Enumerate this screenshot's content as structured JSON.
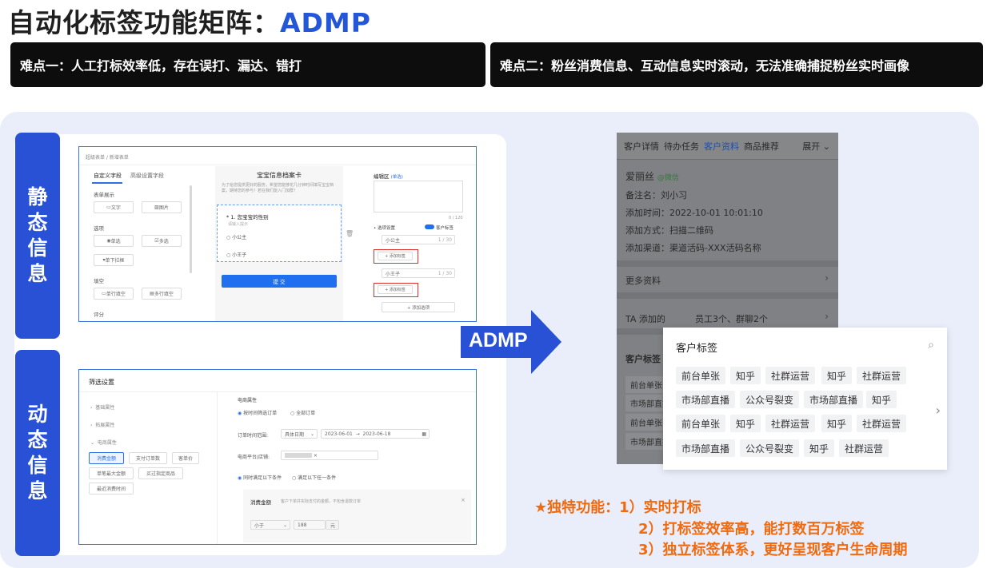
{
  "title": {
    "main": "自动化标签功能矩阵：",
    "accent": "ADMP"
  },
  "pain_points": [
    "难点一：人工打标效率低，存在误打、漏达、错打",
    "难点二：粉丝消费信息、互动信息实时滚动，无法准确捕捉粉丝实时画像"
  ],
  "side_labels": {
    "static": [
      "静",
      "态",
      "信",
      "息"
    ],
    "dynamic": [
      "动",
      "态",
      "信",
      "息"
    ]
  },
  "static_shot": {
    "breadcrumb": "超级表单 / 新增表单",
    "tabs": [
      "自定义字段",
      "高级设置字段"
    ],
    "sections": [
      {
        "title": "表单展示",
        "items": [
          "文字",
          "图片"
        ]
      },
      {
        "title": "选项",
        "items": [
          "单选",
          "多选",
          "单下拉框"
        ]
      },
      {
        "title": "填空",
        "items": [
          "单行填空",
          "多行填空"
        ]
      },
      {
        "title": "评分",
        "items": []
      }
    ],
    "card_title": "宝宝信息档案卡",
    "card_desc": "为了给您提供更好的服务，希望您能够花几分钟时间填写宝宝档案，期待您的参与！若在我们能入门加群！",
    "question": "* 1. 您宝宝的性别",
    "question_hint": "请输入提示",
    "options": [
      "小公主",
      "小王子"
    ],
    "submit": "提 交",
    "edit_title": "编辑区",
    "edit_sub": "(单选)",
    "counter": "0 / 120",
    "option_setting": "• 选项设置",
    "customer_tag": "客户标签",
    "edit_options": [
      {
        "value": "小公主",
        "count": "1 / 30"
      },
      {
        "value": "小王子",
        "count": "1 / 30"
      }
    ],
    "add_tag": "+ 添加标签",
    "add_option": "+ 添加选项"
  },
  "dynamic_shot": {
    "title": "筛选设置",
    "attrs": [
      "基础属性",
      "拓展属性",
      "电商属性"
    ],
    "buttons": [
      "消费金额",
      "支付订单数",
      "客单价",
      "单笔最大金额",
      "买过指定商品",
      "最近消费时间"
    ],
    "ecom_title": "电商属性",
    "radio1": [
      "按时间筛选订单",
      "全部订单"
    ],
    "order_time_label": "订单时间范围:",
    "date_mode": "具体日期",
    "date_from": "2023-06-01",
    "date_to": "2023-06-18",
    "platform_label": "电商平台/店铺:",
    "radio2": [
      "同时满足以下条件",
      "满足以下任一条件"
    ],
    "cond_title": "消费金额",
    "cond_desc": "客户下单并实际支付的金额，不包含退款订单",
    "cond_op": "小于",
    "cond_value": "188",
    "cond_unit": "元"
  },
  "arrow_label": "ADMP",
  "phone": {
    "tabs": [
      "客户详情",
      "待办任务",
      "客户资料",
      "商品推荐"
    ],
    "active_tab": 2,
    "expand": "展开",
    "name": "爱丽丝",
    "wechat": "@微信",
    "rows": [
      "备注名：刘小习",
      "添加时间：2022-10-01 10:01:10",
      "添加方式：扫描二维码",
      "添加渠道：渠道活码-XXX活码名称"
    ],
    "more": "更多资料",
    "ta_label": "TA 添加的",
    "ta_value": "员工3个、群聊2个",
    "tag_section": "客户标签",
    "left_tags": [
      "前台单张",
      "市场部直播",
      "前台单张",
      "市场部直播"
    ]
  },
  "tag_card": {
    "title": "客户标签",
    "rows": [
      [
        "前台单张",
        "知乎",
        "社群运营",
        "知乎",
        "社群运营"
      ],
      [
        "市场部直播",
        "公众号裂变",
        "市场部直播",
        "知乎"
      ],
      [
        "前台单张",
        "知乎",
        "社群运营",
        "知乎",
        "社群运营"
      ],
      [
        "市场部直播",
        "公众号裂变",
        "知乎",
        "社群运营"
      ]
    ]
  },
  "features": [
    "★独特功能：1）实时打标",
    "2）打标签效率高，能打数百万标签",
    "3）独立标签体系，更好呈现客户生命周期"
  ],
  "colors": {
    "brand_blue": "#2951d6",
    "accent_orange": "#f06a0f",
    "tag_red": "#e0322a"
  }
}
